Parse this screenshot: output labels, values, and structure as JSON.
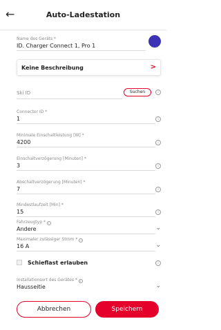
{
  "header": {
    "title": "Auto-Ladestation",
    "back_icon": "←"
  },
  "fields": {
    "device_name": {
      "label": "Name des Geräts *",
      "value": "ID. Charger Connect 1, Pro 1"
    },
    "description": {
      "label": "Keine Beschreibung",
      "arrow": ">"
    },
    "ski_id": {
      "label": "Ski ID",
      "button": "Suchen"
    },
    "connector_id": {
      "label": "Connector ID *",
      "value": "1"
    },
    "min_power": {
      "label": "Minimale Einschaltleistung [W] *",
      "value": "4200"
    },
    "on_delay": {
      "label": "Einschaltverzögerung [Minuten] *",
      "value": "3"
    },
    "off_delay": {
      "label": "Abschaltverzögerung [Minuten] *",
      "value": "7"
    },
    "min_runtime": {
      "label": "Mindestlaufzeit [Min] *",
      "value": "15"
    },
    "vehicle_type": {
      "label": "Fahrzeugtyp *",
      "value": "Andere"
    },
    "max_current": {
      "label": "Maximaler zulässiger Strom *",
      "value": "16 A"
    },
    "unbalanced": {
      "label": "Schieflast erlauben"
    },
    "install_location": {
      "label": "Installationsort des Gerätes *",
      "value": "Hausseitie"
    }
  },
  "buttons": {
    "cancel": "Abbrechen",
    "save": "Speichern"
  },
  "icons": {
    "info": "i",
    "chevron": "⌄"
  },
  "colors": {
    "accent": "#e4002b",
    "device_color": "#3d32b4"
  }
}
